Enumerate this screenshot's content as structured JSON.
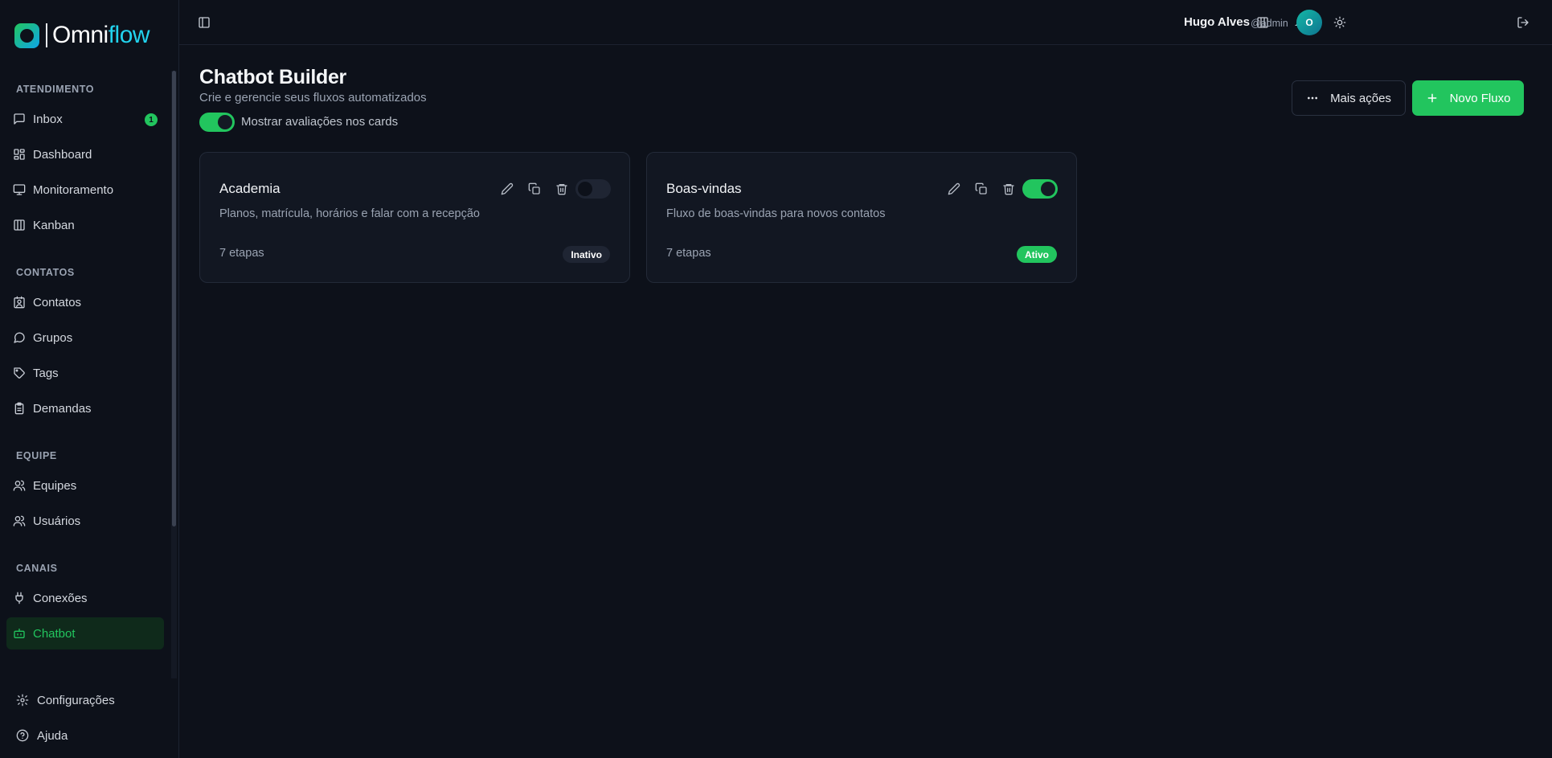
{
  "brand": {
    "name_part1": "Omni",
    "name_part2": "flow"
  },
  "sidebar": {
    "sections": [
      {
        "title": "ATENDIMENTO",
        "items": [
          {
            "label": "Inbox",
            "icon": "message-square-icon",
            "badge": "1"
          },
          {
            "label": "Dashboard",
            "icon": "layout-dashboard-icon"
          },
          {
            "label": "Monitoramento",
            "icon": "monitor-icon"
          },
          {
            "label": "Kanban",
            "icon": "columns-icon"
          }
        ]
      },
      {
        "title": "CONTATOS",
        "items": [
          {
            "label": "Contatos",
            "icon": "contact-icon"
          },
          {
            "label": "Grupos",
            "icon": "message-circle-icon"
          },
          {
            "label": "Tags",
            "icon": "tag-icon"
          },
          {
            "label": "Demandas",
            "icon": "clipboard-icon"
          }
        ]
      },
      {
        "title": "EQUIPE",
        "items": [
          {
            "label": "Equipes",
            "icon": "users-icon"
          },
          {
            "label": "Usuários",
            "icon": "user-icon"
          }
        ]
      },
      {
        "title": "CANAIS",
        "items": [
          {
            "label": "Conexões",
            "icon": "plug-icon"
          },
          {
            "label": "Chatbot",
            "icon": "bot-icon",
            "active": true
          }
        ]
      }
    ],
    "bottom": [
      {
        "label": "Configurações",
        "icon": "gear-icon"
      },
      {
        "label": "Ajuda",
        "icon": "help-circle-icon"
      }
    ]
  },
  "header": {
    "user_name": "Hugo Alves",
    "user_handle": "@admin",
    "avatar_initial": "O"
  },
  "main": {
    "title": "Chatbot Builder",
    "subtitle": "Crie e gerencie seus fluxos automatizados",
    "show_ratings_label": "Mostrar avaliações nos cards",
    "show_ratings_on": true,
    "more_actions_label": "Mais ações",
    "new_flow_label": "Novo Fluxo",
    "flows": [
      {
        "name": "Academia",
        "description": "Planos, matrícula, horários e falar com a recepção",
        "steps": "7 etapas",
        "status": "Inativo",
        "enabled": false
      },
      {
        "name": "Boas-vindas",
        "description": "Fluxo de boas-vindas para novos contatos",
        "steps": "7 etapas",
        "status": "Ativo",
        "enabled": true
      }
    ]
  },
  "colors": {
    "accent": "#22c55e",
    "background": "#0d111a",
    "card": "#121722"
  }
}
